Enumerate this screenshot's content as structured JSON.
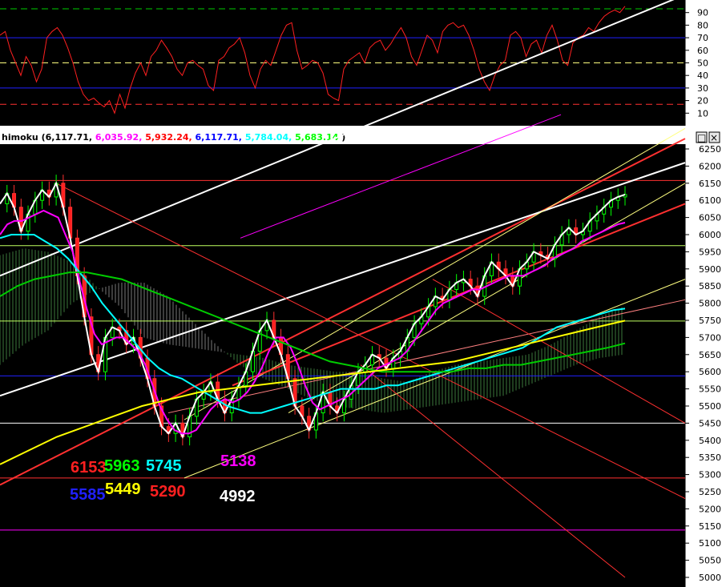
{
  "window": {
    "header_prefix": "himoku",
    "header_values": [
      {
        "text": "6,117.71,",
        "color": "#000000"
      },
      {
        "text": "6,035.92,",
        "color": "#ff00ff"
      },
      {
        "text": "5,932.24,",
        "color": "#ff0000"
      },
      {
        "text": "6,117.71,",
        "color": "#0000ff"
      },
      {
        "text": "5,784.04,",
        "color": "#00ffff"
      },
      {
        "text": "5,683.14",
        "color": "#00ff00"
      },
      {
        "text": ")",
        "color": "#000000"
      }
    ],
    "buttons": {
      "restore": "□",
      "close": "×"
    }
  },
  "chart_data": [
    {
      "type": "line",
      "panel": "oscillator",
      "ylim": [
        0,
        100
      ],
      "ticks": [
        10,
        20,
        30,
        40,
        50,
        60,
        70,
        80,
        90
      ],
      "levels": [
        {
          "value": 93,
          "color": "#00cc00",
          "style": "dash"
        },
        {
          "value": 70,
          "color": "#2020ff",
          "style": "solid"
        },
        {
          "value": 50,
          "color": "#ffff80",
          "style": "dash"
        },
        {
          "value": 30,
          "color": "#2020ff",
          "style": "solid"
        },
        {
          "value": 17,
          "color": "#ff3030",
          "style": "dash"
        }
      ],
      "series": [
        {
          "color": "#ff2020",
          "values": [
            72,
            75,
            60,
            50,
            40,
            55,
            48,
            35,
            45,
            70,
            75,
            78,
            72,
            62,
            50,
            35,
            25,
            20,
            22,
            18,
            15,
            20,
            10,
            25,
            14,
            30,
            42,
            50,
            40,
            55,
            60,
            68,
            62,
            55,
            45,
            40,
            50,
            52,
            48,
            45,
            32,
            28,
            52,
            55,
            62,
            65,
            70,
            58,
            40,
            30,
            45,
            52,
            48,
            60,
            72,
            80,
            82,
            60,
            45,
            48,
            52,
            50,
            42,
            25,
            22,
            20,
            45,
            52,
            55,
            58,
            50,
            62,
            66,
            68,
            60,
            65,
            72,
            78,
            70,
            55,
            48,
            60,
            72,
            68,
            58,
            75,
            80,
            82,
            78,
            80,
            72,
            60,
            45,
            35,
            28,
            40,
            48,
            52,
            72,
            75,
            70,
            55,
            65,
            68,
            58,
            72,
            80,
            68,
            52,
            48,
            66,
            70,
            72,
            78,
            75,
            82,
            87,
            90,
            92,
            90,
            95
          ]
        }
      ]
    },
    {
      "type": "candlestick",
      "panel": "price",
      "ylim": [
        5000,
        6250
      ],
      "ticks": [
        5000,
        5050,
        5100,
        5150,
        5200,
        5250,
        5300,
        5350,
        5400,
        5450,
        5500,
        5550,
        5600,
        5650,
        5700,
        5750,
        5800,
        5850,
        5900,
        5950,
        6000,
        6050,
        6100,
        6150,
        6200,
        6250
      ],
      "legend_header": "himoku (6,117.71, 6,035.92, 5,932.24, 6,117.71, 5,784.04, 5,683.14 )",
      "horizontal_levels": [
        {
          "value": 6158,
          "color": "#ff3030"
        },
        {
          "value": 5968,
          "color": "#c0ff60"
        },
        {
          "value": 5748,
          "color": "#c0ff60"
        },
        {
          "value": 5588,
          "color": "#2020ff"
        },
        {
          "value": 5450,
          "color": "#ffffff"
        },
        {
          "value": 5290,
          "color": "#ff3030"
        },
        {
          "value": 5138,
          "color": "#ff00ff"
        }
      ],
      "annotations": [
        {
          "text": "6153",
          "color": "#ff2020"
        },
        {
          "text": "5963",
          "color": "#00ff00"
        },
        {
          "text": "5745",
          "color": "#00ffff"
        },
        {
          "text": "5138",
          "color": "#ff00ff"
        },
        {
          "text": "5585",
          "color": "#2020ff"
        },
        {
          "text": "5449",
          "color": "#ffff00"
        },
        {
          "text": "5290",
          "color": "#ff2020"
        },
        {
          "text": "4992",
          "color": "#ffffff"
        }
      ],
      "series": [
        {
          "name": "",
          "color": "#ffffff",
          "kind": "close",
          "values": [
            6090,
            6120,
            6080,
            6010,
            6060,
            6100,
            6130,
            6110,
            6150,
            6080,
            5990,
            5880,
            5760,
            5650,
            5600,
            5700,
            5730,
            5720,
            5680,
            5700,
            5640,
            5580,
            5500,
            5440,
            5420,
            5450,
            5410,
            5470,
            5520,
            5540,
            5570,
            5520,
            5480,
            5520,
            5560,
            5600,
            5660,
            5720,
            5750,
            5700,
            5650,
            5580,
            5500,
            5470,
            5430,
            5480,
            5540,
            5500,
            5480,
            5520,
            5560,
            5600,
            5620,
            5650,
            5640,
            5610,
            5640,
            5660,
            5700,
            5740,
            5760,
            5790,
            5820,
            5810,
            5840,
            5860,
            5870,
            5850,
            5820,
            5880,
            5920,
            5900,
            5880,
            5850,
            5900,
            5920,
            5950,
            5940,
            5930,
            5970,
            6000,
            6020,
            6000,
            6010,
            6040,
            6060,
            6080,
            6100,
            6110,
            6117
          ]
        },
        {
          "name": "",
          "color": "#ff00ff",
          "kind": "ma",
          "values": [
            6000,
            6030,
            6040,
            6040,
            6050,
            6060,
            6070,
            6060,
            6050,
            6000,
            5950,
            5860,
            5780,
            5710,
            5680,
            5690,
            5700,
            5700,
            5680,
            5660,
            5620,
            5560,
            5500,
            5460,
            5430,
            5420,
            5420,
            5430,
            5460,
            5490,
            5510,
            5520,
            5510,
            5520,
            5540,
            5570,
            5610,
            5660,
            5700,
            5700,
            5670,
            5620,
            5560,
            5510,
            5490,
            5500,
            5510,
            5520,
            5530,
            5550,
            5570,
            5590,
            5610,
            5620,
            5630,
            5640,
            5660,
            5690,
            5720,
            5750,
            5780,
            5800,
            5810,
            5820,
            5830,
            5840,
            5840,
            5850,
            5860,
            5870,
            5880,
            5880,
            5880,
            5890,
            5900,
            5910,
            5930,
            5940,
            5950,
            5960,
            5980,
            5990,
            6000,
            6010,
            6020,
            6030,
            6035
          ]
        },
        {
          "name": "",
          "color": "#00ffff",
          "kind": "ma",
          "values": [
            5990,
            6000,
            6000,
            6000,
            5980,
            5960,
            5930,
            5890,
            5850,
            5800,
            5760,
            5720,
            5680,
            5640,
            5610,
            5590,
            5580,
            5560,
            5540,
            5520,
            5500,
            5490,
            5480,
            5480,
            5490,
            5500,
            5510,
            5520,
            5530,
            5540,
            5550,
            5550,
            5550,
            5550,
            5560,
            5560,
            5570,
            5580,
            5590,
            5600,
            5610,
            5620,
            5630,
            5640,
            5650,
            5660,
            5670,
            5690,
            5710,
            5730,
            5740,
            5750,
            5760,
            5770,
            5780,
            5784
          ]
        },
        {
          "name": "",
          "color": "#00cc00",
          "kind": "ma",
          "values": [
            5820,
            5850,
            5870,
            5880,
            5890,
            5890,
            5880,
            5870,
            5850,
            5830,
            5810,
            5790,
            5770,
            5750,
            5730,
            5710,
            5690,
            5670,
            5650,
            5630,
            5620,
            5610,
            5600,
            5600,
            5600,
            5600,
            5600,
            5610,
            5610,
            5620,
            5620,
            5630,
            5640,
            5650,
            5660,
            5670,
            5683
          ]
        },
        {
          "name": "",
          "color": "#ffff00",
          "kind": "ma",
          "values": [
            5330,
            5370,
            5410,
            5440,
            5470,
            5500,
            5520,
            5540,
            5550,
            5560,
            5570,
            5580,
            5590,
            5600,
            5610,
            5620,
            5630,
            5650,
            5670,
            5690,
            5710,
            5730,
            5749
          ]
        }
      ]
    }
  ]
}
